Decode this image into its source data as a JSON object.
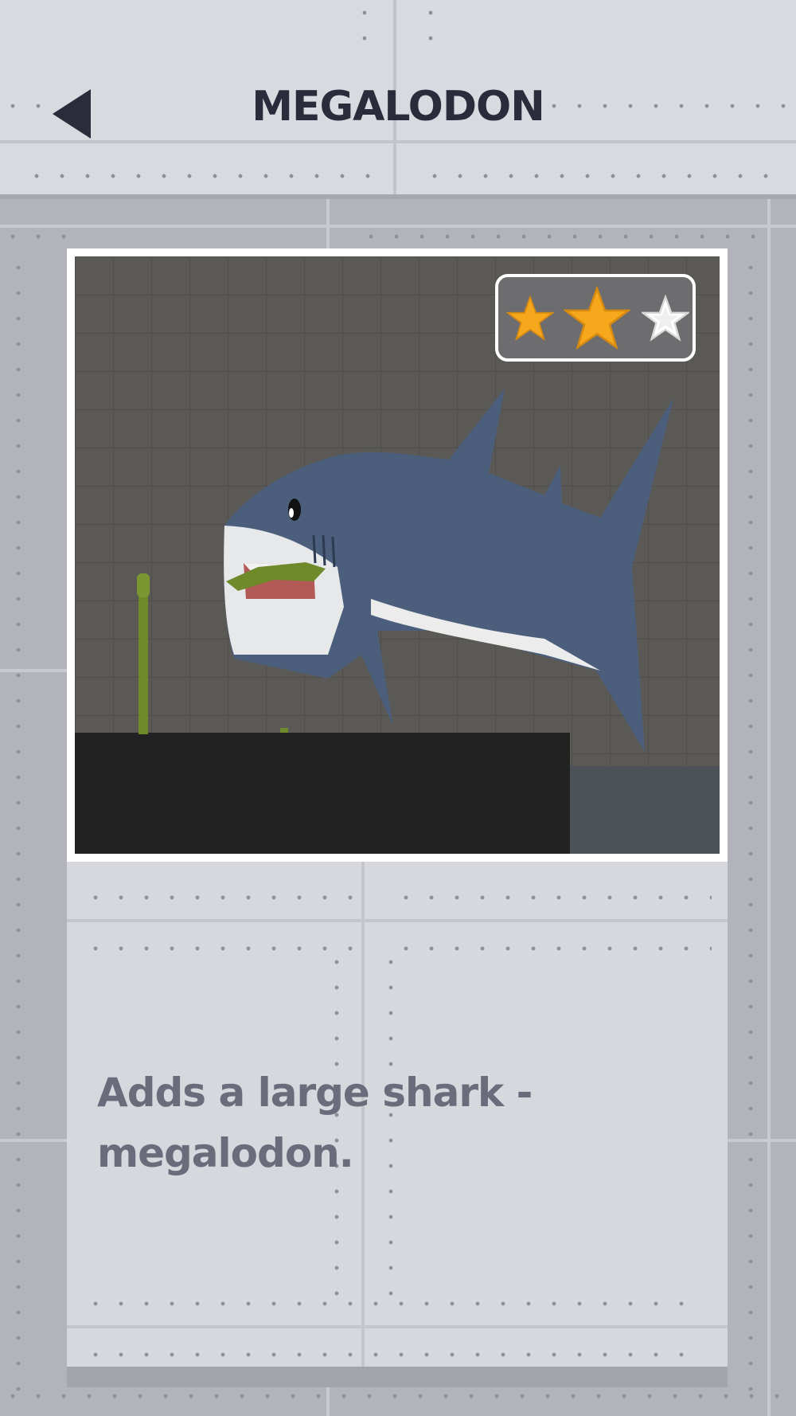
{
  "header": {
    "title": "MEGALODON",
    "back_icon": "back-arrow-icon"
  },
  "mod": {
    "rating": {
      "filled": 2,
      "max": 3,
      "filled_color": "#f5a81c",
      "empty_color": "#ffffff"
    },
    "description": "Adds a large shark - megalodon."
  },
  "colors": {
    "title": "#2a2c3b",
    "description": "#6a6c7c",
    "panel": "#d9dadf",
    "background": "#b3b4bb"
  }
}
